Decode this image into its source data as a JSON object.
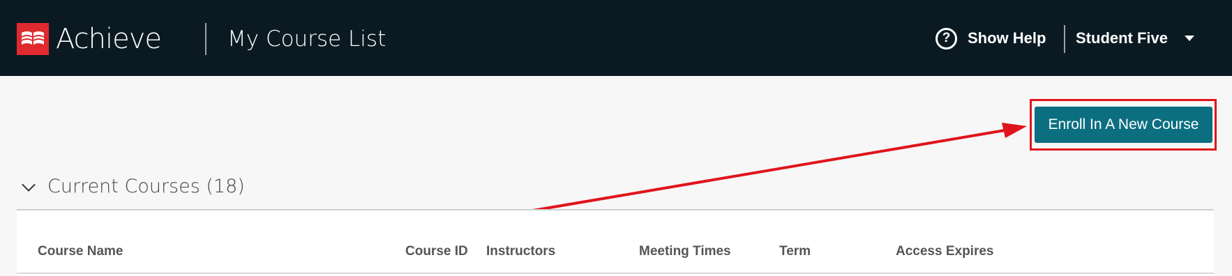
{
  "header": {
    "logo_text": "Achieve",
    "page_title": "My Course List",
    "help_label": "Show Help",
    "user_name": "Student Five"
  },
  "actions": {
    "enroll_label": "Enroll In A New Course"
  },
  "section": {
    "title": "Current Courses (18)"
  },
  "table": {
    "columns": [
      "Course Name",
      "Course ID",
      "Instructors",
      "Meeting Times",
      "Term",
      "Access Expires"
    ]
  },
  "colors": {
    "header_bg": "#0b1a22",
    "brand_red": "#e02a2f",
    "button_teal": "#0c6f80",
    "annotation_red": "#e0141b"
  },
  "icons": [
    "logo-mark-icon",
    "help-circle-icon",
    "caret-down-icon",
    "chevron-down-icon"
  ]
}
